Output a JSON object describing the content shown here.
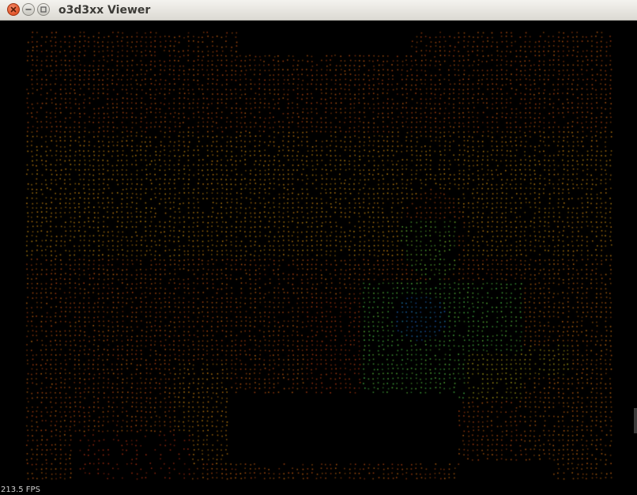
{
  "window": {
    "title": "o3d3xx Viewer",
    "buttons": {
      "close": "close-icon",
      "minimize": "minimize-icon",
      "maximize": "maximize-icon"
    }
  },
  "viewport": {
    "content": "point-cloud",
    "background": "#000000",
    "fps_text": "213.5 FPS"
  },
  "colors": {
    "far": "#a52a12",
    "mid": "#9aa21e",
    "near": "#1e9a4a",
    "closest": "#2040c0"
  }
}
